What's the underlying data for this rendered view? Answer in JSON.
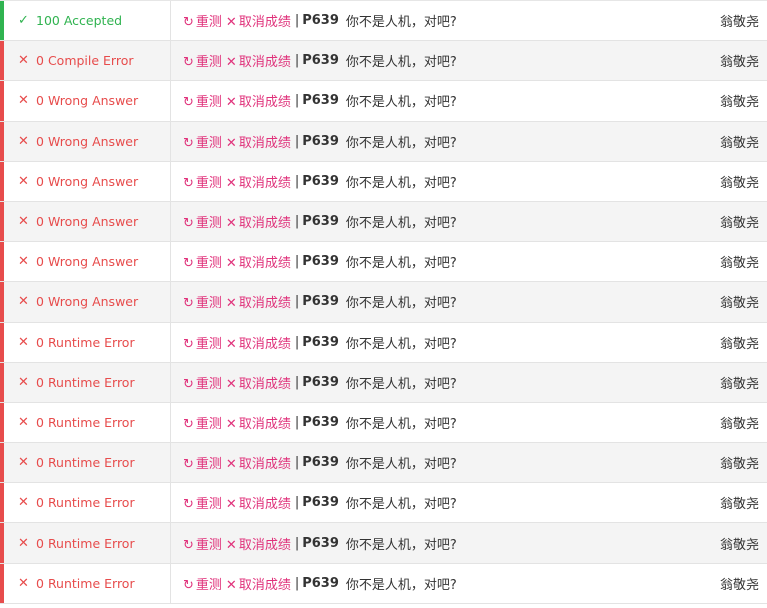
{
  "colors": {
    "accepted": "#30b350",
    "error": "#e74c4c",
    "action": "#e0327b",
    "text": "#333333"
  },
  "rows": [
    {
      "kind": "ok",
      "icon": "check-icon",
      "score": "100",
      "status": "Accepted",
      "rejudge": "重测",
      "cancel": "取消成绩",
      "sep": "|",
      "pid": "P639",
      "title": "你不是人机，对吧?",
      "user": "翁敬尧"
    },
    {
      "kind": "err",
      "icon": "cross-icon",
      "score": "0",
      "status": "Compile Error",
      "rejudge": "重测",
      "cancel": "取消成绩",
      "sep": "|",
      "pid": "P639",
      "title": "你不是人机，对吧?",
      "user": "翁敬尧"
    },
    {
      "kind": "err",
      "icon": "cross-icon",
      "score": "0",
      "status": "Wrong Answer",
      "rejudge": "重测",
      "cancel": "取消成绩",
      "sep": "|",
      "pid": "P639",
      "title": "你不是人机，对吧?",
      "user": "翁敬尧"
    },
    {
      "kind": "err",
      "icon": "cross-icon",
      "score": "0",
      "status": "Wrong Answer",
      "rejudge": "重测",
      "cancel": "取消成绩",
      "sep": "|",
      "pid": "P639",
      "title": "你不是人机，对吧?",
      "user": "翁敬尧"
    },
    {
      "kind": "err",
      "icon": "cross-icon",
      "score": "0",
      "status": "Wrong Answer",
      "rejudge": "重测",
      "cancel": "取消成绩",
      "sep": "|",
      "pid": "P639",
      "title": "你不是人机，对吧?",
      "user": "翁敬尧"
    },
    {
      "kind": "err",
      "icon": "cross-icon",
      "score": "0",
      "status": "Wrong Answer",
      "rejudge": "重测",
      "cancel": "取消成绩",
      "sep": "|",
      "pid": "P639",
      "title": "你不是人机，对吧?",
      "user": "翁敬尧"
    },
    {
      "kind": "err",
      "icon": "cross-icon",
      "score": "0",
      "status": "Wrong Answer",
      "rejudge": "重测",
      "cancel": "取消成绩",
      "sep": "|",
      "pid": "P639",
      "title": "你不是人机，对吧?",
      "user": "翁敬尧"
    },
    {
      "kind": "err",
      "icon": "cross-icon",
      "score": "0",
      "status": "Wrong Answer",
      "rejudge": "重测",
      "cancel": "取消成绩",
      "sep": "|",
      "pid": "P639",
      "title": "你不是人机，对吧?",
      "user": "翁敬尧"
    },
    {
      "kind": "err",
      "icon": "cross-icon",
      "score": "0",
      "status": "Runtime Error",
      "rejudge": "重测",
      "cancel": "取消成绩",
      "sep": "|",
      "pid": "P639",
      "title": "你不是人机，对吧?",
      "user": "翁敬尧"
    },
    {
      "kind": "err",
      "icon": "cross-icon",
      "score": "0",
      "status": "Runtime Error",
      "rejudge": "重测",
      "cancel": "取消成绩",
      "sep": "|",
      "pid": "P639",
      "title": "你不是人机，对吧?",
      "user": "翁敬尧"
    },
    {
      "kind": "err",
      "icon": "cross-icon",
      "score": "0",
      "status": "Runtime Error",
      "rejudge": "重测",
      "cancel": "取消成绩",
      "sep": "|",
      "pid": "P639",
      "title": "你不是人机，对吧?",
      "user": "翁敬尧"
    },
    {
      "kind": "err",
      "icon": "cross-icon",
      "score": "0",
      "status": "Runtime Error",
      "rejudge": "重测",
      "cancel": "取消成绩",
      "sep": "|",
      "pid": "P639",
      "title": "你不是人机，对吧?",
      "user": "翁敬尧"
    },
    {
      "kind": "err",
      "icon": "cross-icon",
      "score": "0",
      "status": "Runtime Error",
      "rejudge": "重测",
      "cancel": "取消成绩",
      "sep": "|",
      "pid": "P639",
      "title": "你不是人机，对吧?",
      "user": "翁敬尧"
    },
    {
      "kind": "err",
      "icon": "cross-icon",
      "score": "0",
      "status": "Runtime Error",
      "rejudge": "重测",
      "cancel": "取消成绩",
      "sep": "|",
      "pid": "P639",
      "title": "你不是人机，对吧?",
      "user": "翁敬尧"
    },
    {
      "kind": "err",
      "icon": "cross-icon",
      "score": "0",
      "status": "Runtime Error",
      "rejudge": "重测",
      "cancel": "取消成绩",
      "sep": "|",
      "pid": "P639",
      "title": "你不是人机，对吧?",
      "user": "翁敬尧"
    }
  ]
}
